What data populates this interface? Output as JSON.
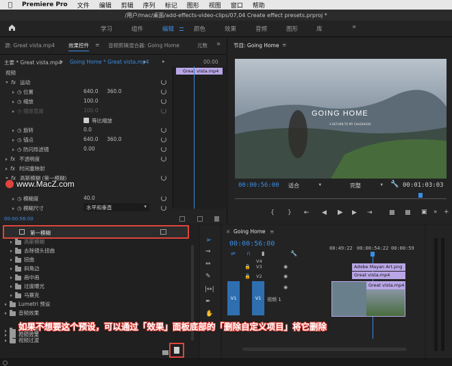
{
  "menubar": {
    "app": "Premiere Pro",
    "items": [
      "文件",
      "编辑",
      "剪辑",
      "序列",
      "标记",
      "图形",
      "视图",
      "窗口",
      "帮助"
    ]
  },
  "window_title": "/用户/mac/桌面/add-effects-video-clips/07,04 Create effect presets.prproj *",
  "workspace_tabs": [
    "学习",
    "组件",
    "编辑",
    "颜色",
    "效果",
    "音频",
    "图形",
    "库"
  ],
  "workspace_active": "编辑",
  "effect_controls": {
    "tabs": [
      "源: Great vista.mp4",
      "效果控件",
      "音频剪辑混合器: Going Home",
      "元数"
    ],
    "clip_master": "主要 * Great vista.mp4",
    "clip_seq": "Going Home * Great vista.mp4",
    "mini_timecode": "00:00",
    "mini_clip": "Great vista.mp4",
    "section_video": "视频",
    "rows": [
      {
        "label": "运动",
        "fx": true
      },
      {
        "label": "位置",
        "v1": "640.0",
        "v2": "360.0"
      },
      {
        "label": "缩放",
        "v1": "100.0"
      },
      {
        "label": "缩放宽度",
        "v1": "100.0",
        "disabled": true
      },
      {
        "label": "等比缩放",
        "checkbox": true
      },
      {
        "label": "旋转",
        "v1": "0.0"
      },
      {
        "label": "锚点",
        "v1": "640.0",
        "v2": "360.0"
      },
      {
        "label": "防闪烁滤镜",
        "v1": "0.00"
      },
      {
        "label": "不透明度",
        "fx": true
      },
      {
        "label": "时间重映射",
        "fx": true
      },
      {
        "label": "高斯模糊 (第一模糊)",
        "fx": true
      },
      {
        "label": "模糊度",
        "v1": "40.0"
      },
      {
        "label": "模糊尺寸",
        "select": "水平和垂直"
      }
    ],
    "bottom_timecode": "00:00:56:00"
  },
  "watermark": "www.MacZ.com",
  "effects_list": {
    "highlighted": "第一模糊",
    "items": [
      "高斯模糊",
      "去除镜头扭曲",
      "扭曲",
      "斜角边",
      "画中画",
      "过度曝光",
      "马赛克"
    ],
    "groups": [
      "Lumetri 预设",
      "音频效果",
      "音频过渡",
      "视频效果",
      "视频过渡"
    ]
  },
  "program": {
    "tab": "节目: Going Home",
    "title": "GOING HOME",
    "subtitle": "A RETURN TO MY CHILDHOOD",
    "timecode": "00:00:56:00",
    "fit": "适合",
    "quality": "完整",
    "duration": "00:01:03:03"
  },
  "timeline": {
    "tab": "Going Home",
    "timecode": "00:00:56:00",
    "ruler": [
      "00:49:22",
      "00:00:54:22",
      "00:00:59"
    ],
    "tracks": [
      "V4",
      "V3",
      "V2",
      "V1"
    ],
    "track_label": "视频 1",
    "clips": [
      "Adobe Mayan Art.png",
      "Great vista.mp4",
      "Great vista.mp4"
    ]
  },
  "annotation": "如果不想要这个预设，可以通过「效果」面板底部的「删除自定义项目」将它删除",
  "colors": {
    "accent": "#3a8ee6",
    "highlight": "#e0443c",
    "clip_purple": "#b9a6e6",
    "clip_blue": "#2f6fb0"
  }
}
